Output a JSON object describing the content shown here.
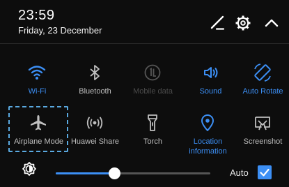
{
  "header": {
    "time": "23:59",
    "date": "Friday, 23 December",
    "edit_icon": "pencil-icon",
    "settings_icon": "gear-icon",
    "collapse_icon": "chevron-up-icon"
  },
  "colors": {
    "accent": "#3c8ff5",
    "label_inactive": "#bfbfbf",
    "label_disabled": "#4b4b4b",
    "highlight_dash": "#5aa9e0"
  },
  "toggles": [
    {
      "label": "Wi-Fi",
      "icon": "wifi-icon",
      "state": "on"
    },
    {
      "label": "Bluetooth",
      "icon": "bluetooth-icon",
      "state": "off"
    },
    {
      "label": "Mobile data",
      "icon": "mobile-data-icon",
      "state": "disabled"
    },
    {
      "label": "Sound",
      "icon": "sound-icon",
      "state": "on"
    },
    {
      "label": "Auto Rotate",
      "icon": "auto-rotate-icon",
      "state": "on"
    },
    {
      "label": "Airplane Mode",
      "icon": "airplane-icon",
      "state": "off",
      "highlighted": true
    },
    {
      "label": "Huawei Share",
      "icon": "huawei-share-icon",
      "state": "off"
    },
    {
      "label": "Torch",
      "icon": "torch-icon",
      "state": "off"
    },
    {
      "label": "Location information",
      "icon": "location-icon",
      "state": "on"
    },
    {
      "label": "Screenshot",
      "icon": "screenshot-icon",
      "state": "off"
    }
  ],
  "brightness": {
    "icon": "brightness-icon",
    "level": 0.38,
    "auto_label": "Auto",
    "auto_checked": true
  }
}
